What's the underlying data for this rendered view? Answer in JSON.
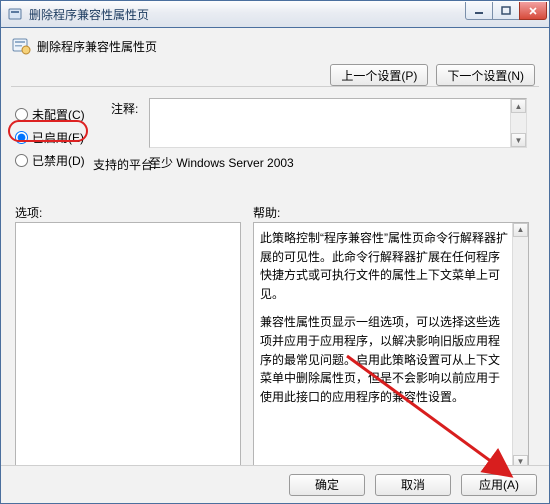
{
  "window": {
    "title": "删除程序兼容性属性页"
  },
  "header": {
    "title": "删除程序兼容性属性页"
  },
  "buttons": {
    "prev": "上一个设置(P)",
    "next": "下一个设置(N)",
    "ok": "确定",
    "cancel": "取消",
    "apply": "应用(A)"
  },
  "radios": {
    "not_configured": "未配置(C)",
    "enabled": "已启用(E)",
    "disabled": "已禁用(D)"
  },
  "labels": {
    "comment": "注释:",
    "platform": "支持的平台:",
    "options": "选项:",
    "help": "帮助:"
  },
  "values": {
    "platform": "至少 Windows Server 2003"
  },
  "help": {
    "p1": "此策略控制“程序兼容性”属性页命令行解释器扩展的可见性。此命令行解释器扩展在任何程序快捷方式或可执行文件的属性上下文菜单上可见。",
    "p2": "兼容性属性页显示一组选项，可以选择这些选项并应用于应用程序，以解决影响旧版应用程序的最常见问题。启用此策略设置可从上下文菜单中删除属性页，但是不会影响以前应用于使用此接口的应用程序的兼容性设置。"
  }
}
